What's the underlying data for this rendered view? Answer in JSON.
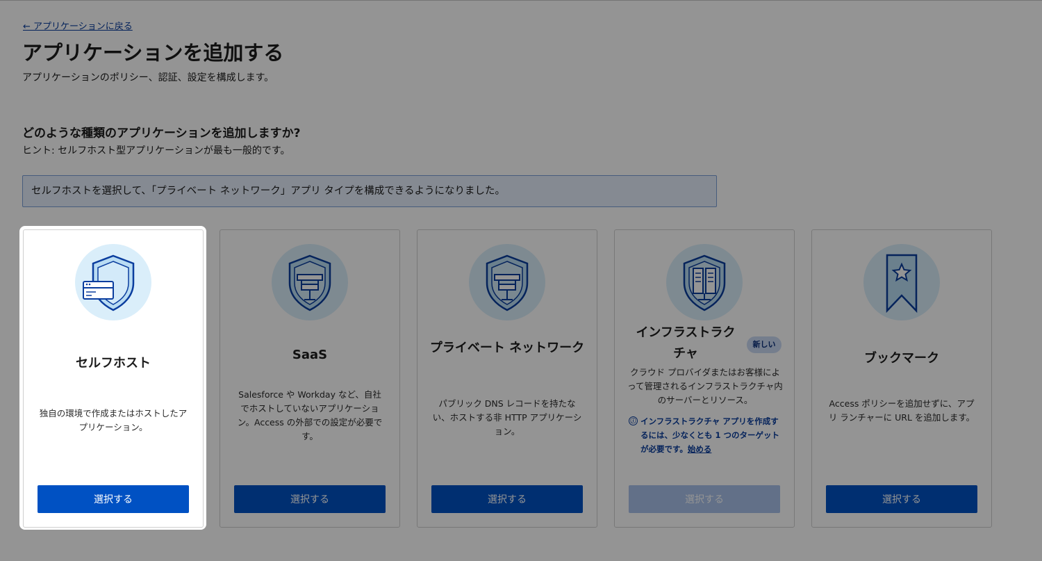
{
  "header": {
    "back_link": "← アプリケーションに戻る",
    "title": "アプリケーションを追加する",
    "subtitle": "アプリケーションのポリシー、認証、設定を構成します。"
  },
  "section": {
    "question": "どのような種類のアプリケーションを追加しますか?",
    "hint": "ヒント: セルフホスト型アプリケーションが最も一般的です。"
  },
  "notice": "セルフホストを選択して、「プライベート ネットワーク」アプリ タイプを構成できるようになりました。",
  "cards": [
    {
      "icon": "shield-server-icon",
      "title": "セルフホスト",
      "description": "独自の環境で作成またはホストしたアプリケーション。",
      "button": "選択する"
    },
    {
      "icon": "shield-network-icon",
      "title": "SaaS",
      "description": "Salesforce や Workday など、自社でホストしていないアプリケーション。Access の外部での設定が必要です。",
      "button": "選択する"
    },
    {
      "icon": "shield-network-icon",
      "title": "プライベート ネットワーク",
      "description": "パブリック DNS レコードを持たない、ホストする非 HTTP アプリケーション。",
      "button": "選択する"
    },
    {
      "icon": "shield-server-rack-icon",
      "title": "インフラストラクチャ",
      "badge": "新しい",
      "description": "クラウド プロバイダまたはお客様によって管理されるインフラストラクチャ内のサーバーとリソース。",
      "note_icon": "ⓘ",
      "note": "インフラストラクチャ アプリを作成するには、少なくとも 1 つのターゲットが必要です。",
      "note_link": "始める",
      "button": "選択する",
      "button_disabled": true
    },
    {
      "icon": "bookmark-star-icon",
      "title": "ブックマーク",
      "description": "Access ポリシーを追加せずに、アプリ ランチャーに URL を追加します。",
      "button": "選択する"
    }
  ],
  "colors": {
    "primary": "#0051c3",
    "primary_disabled": "#a9c2ea",
    "icon_bg": "#daeefa",
    "icon_stroke": "#0a3d9e"
  }
}
